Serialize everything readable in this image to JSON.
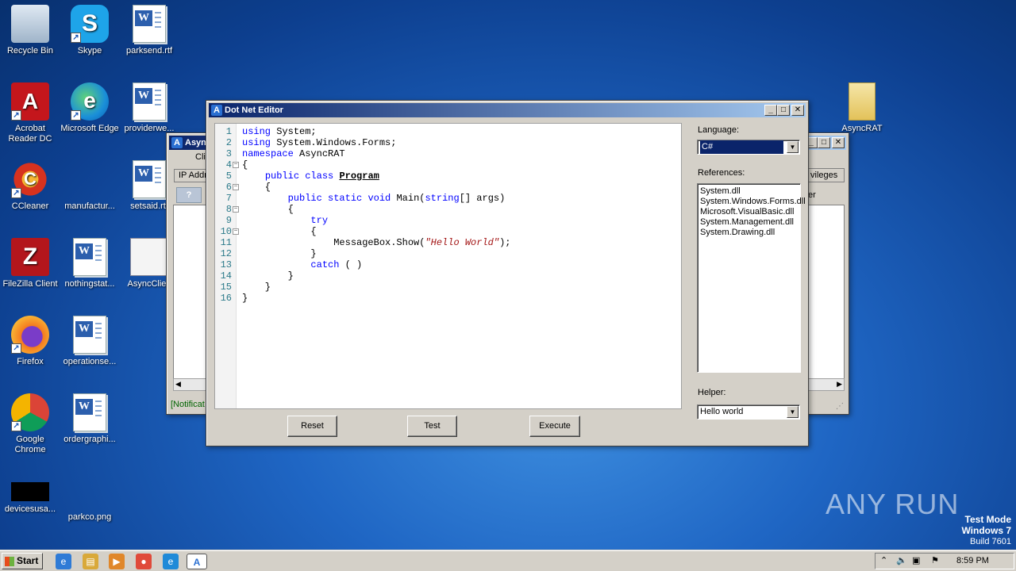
{
  "desktop": {
    "icons": [
      {
        "label": "Recycle Bin",
        "glyph": "🗑"
      },
      {
        "label": "Skype",
        "glyph": "S"
      },
      {
        "label": "parksend.rtf",
        "glyph": "W"
      },
      {
        "label": "Acrobat Reader DC",
        "glyph": "A"
      },
      {
        "label": "Microsoft Edge",
        "glyph": "e"
      },
      {
        "label": "providerwe...",
        "glyph": "W"
      },
      {
        "label": "CCleaner",
        "glyph": "C"
      },
      {
        "label": "manufactur...",
        "glyph": ""
      },
      {
        "label": "setsaid.rtf",
        "glyph": "W"
      },
      {
        "label": "FileZilla Client",
        "glyph": "Z"
      },
      {
        "label": "nothingstat...",
        "glyph": "W"
      },
      {
        "label": "AsyncClien",
        "glyph": ""
      },
      {
        "label": "Firefox",
        "glyph": "🦊"
      },
      {
        "label": "operationse...",
        "glyph": "W"
      },
      {
        "label": "Google Chrome",
        "glyph": "⬤"
      },
      {
        "label": "ordergraphi...",
        "glyph": "W"
      },
      {
        "label": "devicesusa...",
        "glyph": ""
      },
      {
        "label": "parkco.png",
        "glyph": ""
      },
      {
        "label": "AsyncRAT",
        "glyph": "📁"
      }
    ],
    "watermark": {
      "brand": "ANY RUN",
      "line1": "Test Mode",
      "line2": "Windows 7",
      "line3": "Build 7601"
    }
  },
  "bg_window": {
    "title": "Asyn",
    "tab_partial": "Cli",
    "col_header": "IP Addr",
    "right_tab": "vileges",
    "right_col": "er",
    "status": "[Notificat"
  },
  "editor_window": {
    "title": "Dot Net Editor",
    "code_lines": [
      {
        "n": "1",
        "fold": "",
        "html": "<span class='kw'>using</span> System;"
      },
      {
        "n": "2",
        "fold": "",
        "html": "<span class='kw'>using</span> System.Windows.Forms;"
      },
      {
        "n": "3",
        "fold": "",
        "html": "<span class='kw'>namespace</span> AsyncRAT"
      },
      {
        "n": "4",
        "fold": "−",
        "html": "{"
      },
      {
        "n": "5",
        "fold": "",
        "html": "    <span class='kw'>public</span> <span class='kw'>class</span> <span class='ty'>Program</span>"
      },
      {
        "n": "6",
        "fold": "−",
        "html": "    {"
      },
      {
        "n": "7",
        "fold": "",
        "html": "        <span class='kw'>public</span> <span class='kw'>static</span> <span class='kw'>void</span> Main(<span class='kw'>string</span>[] args)"
      },
      {
        "n": "8",
        "fold": "−",
        "html": "        {"
      },
      {
        "n": "9",
        "fold": "",
        "html": "            <span class='kw'>try</span>"
      },
      {
        "n": "10",
        "fold": "−",
        "html": "            {"
      },
      {
        "n": "11",
        "fold": "",
        "html": "                MessageBox.Show(<span class='str'>\"Hello World\"</span>);"
      },
      {
        "n": "12",
        "fold": "",
        "html": "            }"
      },
      {
        "n": "13",
        "fold": "",
        "html": "            <span class='kw'>catch</span> ( )"
      },
      {
        "n": "14",
        "fold": "",
        "html": "        }"
      },
      {
        "n": "15",
        "fold": "",
        "html": "    }"
      },
      {
        "n": "16",
        "fold": "",
        "html": "}"
      }
    ],
    "language_label": "Language:",
    "language_value": "C#",
    "references_label": "References:",
    "references": [
      "System.dll",
      "System.Windows.Forms.dll",
      "Microsoft.VisualBasic.dll",
      "System.Management.dll",
      "System.Drawing.dll"
    ],
    "helper_label": "Helper:",
    "helper_value": "Hello world",
    "buttons": {
      "reset": "Reset",
      "test": "Test",
      "execute": "Execute"
    }
  },
  "taskbar": {
    "start_label": "Start",
    "clock": "8:59 PM"
  }
}
